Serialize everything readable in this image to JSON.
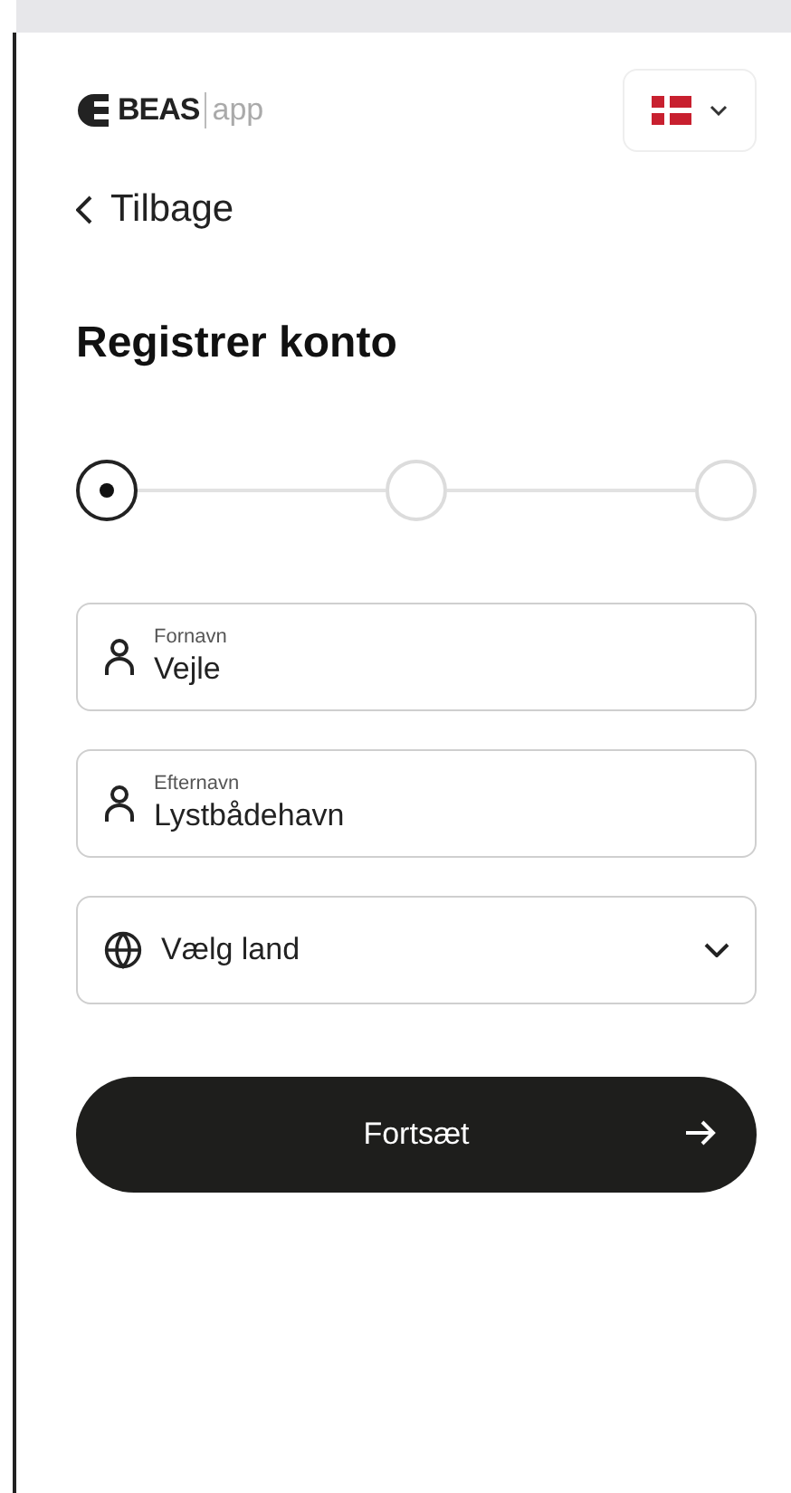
{
  "header": {
    "logo_text": "BEAS",
    "logo_suffix": "app"
  },
  "back": {
    "label": "Tilbage"
  },
  "title": "Registrer konto",
  "steps": [
    {
      "selected": true
    },
    {
      "selected": false
    },
    {
      "selected": false
    }
  ],
  "fields": [
    {
      "kind": "text",
      "label": "Fornavn",
      "value": "Vejle"
    },
    {
      "kind": "text",
      "label": "Efternavn",
      "value": "Lystbådehavn"
    },
    {
      "kind": "select",
      "placeholder": "Vælg land"
    }
  ],
  "button": {
    "label": "Fortsæt"
  }
}
